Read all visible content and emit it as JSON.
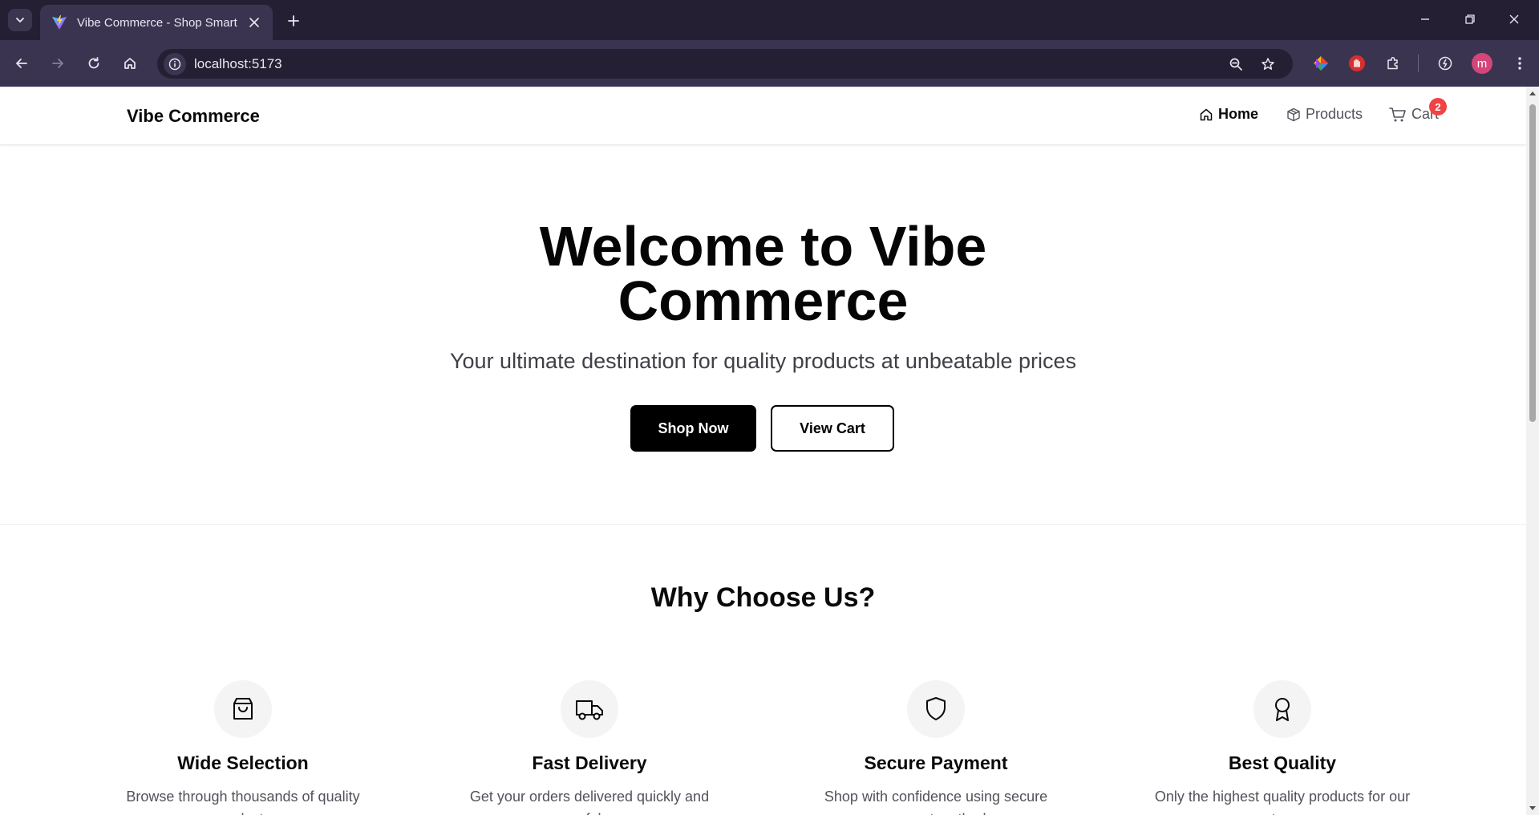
{
  "browser": {
    "tab_title": "Vibe Commerce - Shop Smart",
    "url": "localhost:5173",
    "profile_initial": "m"
  },
  "header": {
    "brand": "Vibe Commerce",
    "nav": {
      "home": "Home",
      "products": "Products",
      "cart": "Cart"
    },
    "cart_count": "2"
  },
  "hero": {
    "title": "Welcome to Vibe Commerce",
    "subtitle": "Your ultimate destination for quality products at unbeatable prices",
    "primary_button": "Shop Now",
    "secondary_button": "View Cart"
  },
  "features": {
    "title": "Why Choose Us?",
    "items": [
      {
        "icon": "shopping-bag-icon",
        "title": "Wide Selection",
        "desc": "Browse through thousands of quality products"
      },
      {
        "icon": "truck-icon",
        "title": "Fast Delivery",
        "desc": "Get your orders delivered quickly and safely"
      },
      {
        "icon": "shield-icon",
        "title": "Secure Payment",
        "desc": "Shop with confidence using secure payment methods"
      },
      {
        "icon": "award-icon",
        "title": "Best Quality",
        "desc": "Only the highest quality products for our customers"
      }
    ]
  },
  "colors": {
    "tabbar": "#241f33",
    "toolbar": "#3a3450",
    "badge": "#ef4444",
    "primary": "#000000"
  }
}
